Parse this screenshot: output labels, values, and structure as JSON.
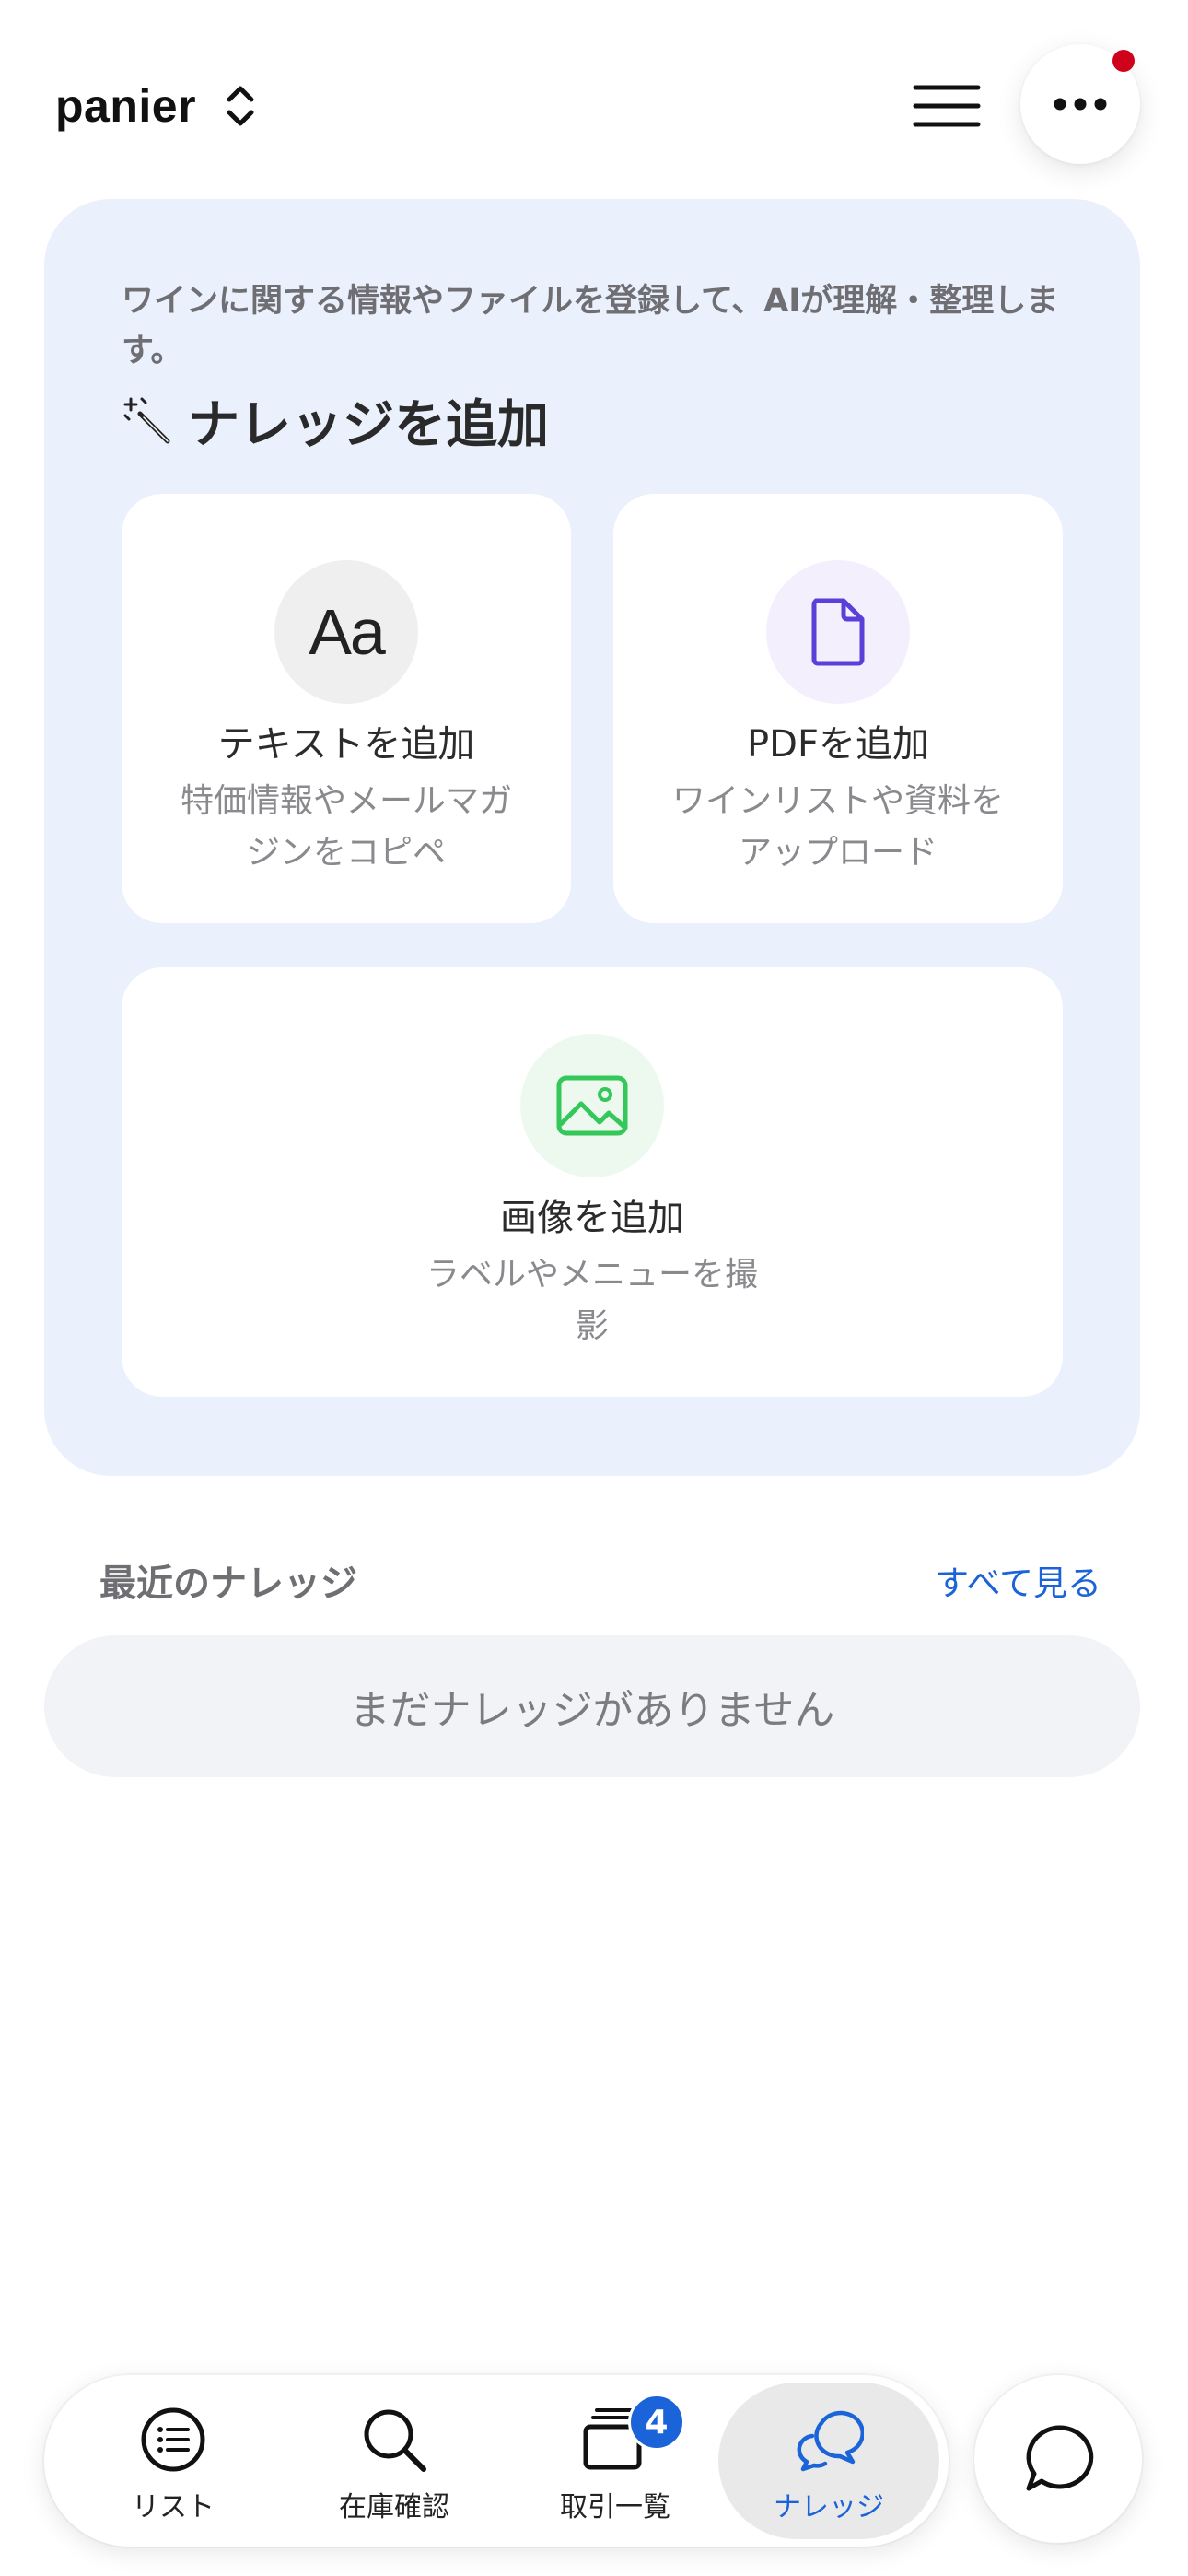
{
  "header": {
    "store_name": "panier",
    "switch_icon": "chevron-up-down-icon",
    "menu_icon": "hamburger-menu-icon",
    "more_icon": "more-dots-icon",
    "notification_color": "#d0021b"
  },
  "add_knowledge": {
    "intro": "ワインに関する情報やファイルを登録して、AIが理解・整理します。",
    "title": "ナレッジを追加",
    "title_icon": "magic-wand-icon",
    "background": "#ebf0fd",
    "options": [
      {
        "icon": "text-aa-icon",
        "icon_glyph": "Aa",
        "title": "テキストを追加",
        "description": "特価情報やメールマガジンをコピペ"
      },
      {
        "icon": "document-icon",
        "title": "PDFを追加",
        "description": "ワインリストや資料をアップロード",
        "accent": "#5b3fd9"
      },
      {
        "icon": "image-icon",
        "title": "画像を追加",
        "description": "ラベルやメニューを撮影",
        "accent": "#34c759"
      }
    ]
  },
  "recent": {
    "title": "最近のナレッジ",
    "see_all": "すべて見る",
    "empty_message": "まだナレッジがありません"
  },
  "tabbar": {
    "active_color": "#1b63d8",
    "tabs": [
      {
        "label": "リスト",
        "icon": "list-icon"
      },
      {
        "label": "在庫確認",
        "icon": "search-icon"
      },
      {
        "label": "取引一覧",
        "icon": "stack-icon",
        "badge": "4"
      },
      {
        "label": "ナレッジ",
        "icon": "chat-bubbles-icon",
        "active": true
      }
    ]
  },
  "chat_button": {
    "icon": "chat-bubble-icon"
  }
}
